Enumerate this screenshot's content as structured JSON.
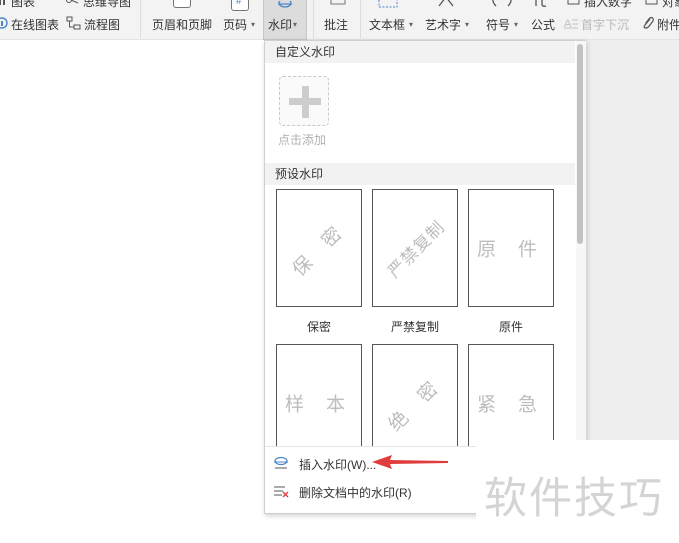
{
  "toolbar": {
    "top_clipped_left": "图表",
    "top_clipped_mid": "思维导图",
    "online_chart": "在线图表",
    "flowchart": "流程图",
    "header_footer": "页眉和页脚",
    "page_number": "页码",
    "watermark": "水印",
    "comment": "批注",
    "textbox": "文本框",
    "wordart": "艺术字",
    "symbol": "符号",
    "formula": "公式",
    "drop_cap": "首字下沉",
    "attachment": "附件",
    "top_clipped_right1": "插入数字",
    "top_clipped_right2": "对象"
  },
  "watermark_panel": {
    "custom_section": "自定义水印",
    "add_label": "点击添加",
    "preset_section": "预设水印",
    "presets": [
      {
        "text": "保 密",
        "caption": "保密"
      },
      {
        "text": "严禁复制",
        "caption": "严禁复制"
      },
      {
        "text": "原 件",
        "caption": "原件"
      },
      {
        "text": "样 本",
        "caption": ""
      },
      {
        "text": "绝 密",
        "caption": ""
      },
      {
        "text": "紧 急",
        "caption": ""
      }
    ],
    "insert_item": "插入水印(W)...",
    "delete_item": "删除文档中的水印(R)"
  },
  "brand_watermark": "软件技巧",
  "colors": {
    "accent_red": "#e03c3c",
    "panel_header": "#f2f2f2",
    "watermark_gray": "#bdbdbd"
  },
  "icons": [
    "chart-icon",
    "mindmap-icon",
    "online-chart-icon",
    "flowchart-icon",
    "header-footer-icon",
    "page-number-icon",
    "watermark-icon",
    "comment-icon",
    "textbox-icon",
    "wordart-icon",
    "symbol-icon",
    "formula-icon",
    "drop-cap-icon",
    "attachment-icon",
    "plus-icon",
    "insert-watermark-icon",
    "delete-watermark-icon",
    "arrow-icon"
  ]
}
